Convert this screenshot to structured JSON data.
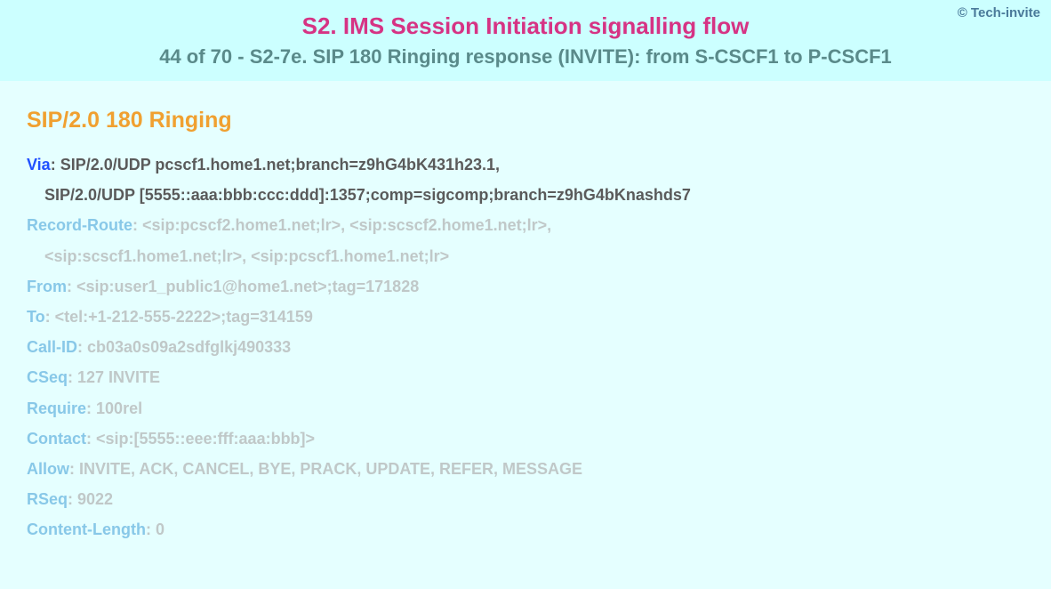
{
  "copyright": "© Tech-invite",
  "title": "S2. IMS Session Initiation signalling flow",
  "subtitle": "44 of 70 - S2-7e. SIP 180 Ringing response (INVITE): from S-CSCF1 to P-CSCF1",
  "status_line": "SIP/2.0 180 Ringing",
  "via": {
    "label": "Via",
    "line1": "SIP/2.0/UDP pcscf1.home1.net;branch=z9hG4bK431h23.1,",
    "line2": "SIP/2.0/UDP [5555::aaa:bbb:ccc:ddd]:1357;comp=sigcomp;branch=z9hG4bKnashds7"
  },
  "record_route": {
    "label": "Record-Route",
    "line1": "<sip:pcscf2.home1.net;lr>, <sip:scscf2.home1.net;lr>,",
    "line2": "<sip:scscf1.home1.net;lr>, <sip:pcscf1.home1.net;lr>"
  },
  "from": {
    "label": "From",
    "value": "<sip:user1_public1@home1.net>;tag=171828"
  },
  "to": {
    "label": "To",
    "value": "<tel:+1-212-555-2222>;tag=314159"
  },
  "call_id": {
    "label": "Call-ID",
    "value": "cb03a0s09a2sdfglkj490333"
  },
  "cseq": {
    "label": "CSeq",
    "value": "127 INVITE"
  },
  "require": {
    "label": "Require",
    "value": "100rel"
  },
  "contact": {
    "label": "Contact",
    "value": "<sip:[5555::eee:fff:aaa:bbb]>"
  },
  "allow": {
    "label": "Allow",
    "value": "INVITE, ACK, CANCEL, BYE, PRACK, UPDATE, REFER, MESSAGE"
  },
  "rseq": {
    "label": "RSeq",
    "value": "9022"
  },
  "content_length": {
    "label": "Content-Length",
    "value": "0"
  }
}
